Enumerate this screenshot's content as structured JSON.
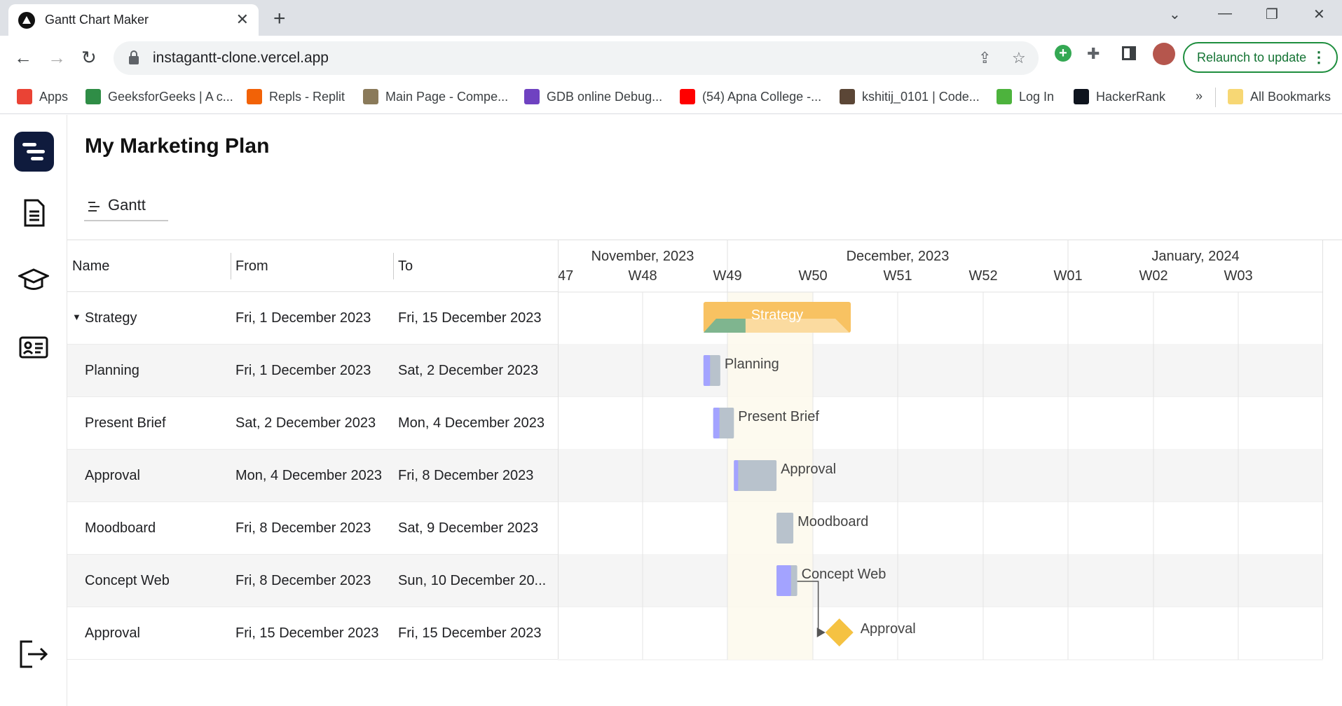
{
  "browser": {
    "tab_title": "Gantt Chart Maker",
    "url": "instagantt-clone.vercel.app",
    "relaunch_label": "Relaunch to update",
    "bookmarks": [
      {
        "label": "Apps",
        "color": "#ea4335"
      },
      {
        "label": "GeeksforGeeks | A c...",
        "color": "#2f8d46"
      },
      {
        "label": "Repls - Replit",
        "color": "#f26207"
      },
      {
        "label": "Main Page - Compe...",
        "color": "#8a7a5a"
      },
      {
        "label": "GDB online Debug...",
        "color": "#6f42c1"
      },
      {
        "label": "(54) Apna College -...",
        "color": "#ff0000"
      },
      {
        "label": "kshitij_0101 | Code...",
        "color": "#5b4636"
      },
      {
        "label": "Log In",
        "color": "#4db33d"
      },
      {
        "label": "HackerRank",
        "color": "#0e141e"
      }
    ],
    "all_bookmarks_label": "All Bookmarks",
    "more_label": "»"
  },
  "app": {
    "title": "My Marketing Plan",
    "view_tab": "Gantt"
  },
  "grid": {
    "headers": {
      "name": "Name",
      "from": "From",
      "to": "To"
    },
    "rows": [
      {
        "name": "Strategy",
        "from": "Fri, 1 December 2023",
        "to": "Fri, 15 December 2023",
        "type": "project",
        "expander": "▼"
      },
      {
        "name": "Planning",
        "from": "Fri, 1 December 2023",
        "to": "Sat, 2 December 2023",
        "type": "task"
      },
      {
        "name": "Present Brief",
        "from": "Sat, 2 December 2023",
        "to": "Mon, 4 December 2023",
        "type": "task"
      },
      {
        "name": "Approval",
        "from": "Mon, 4 December 2023",
        "to": "Fri, 8 December 2023",
        "type": "task"
      },
      {
        "name": "Moodboard",
        "from": "Fri, 8 December 2023",
        "to": "Sat, 9 December 2023",
        "type": "task"
      },
      {
        "name": "Concept Web",
        "from": "Fri, 8 December 2023",
        "to": "Sun, 10 December 20...",
        "type": "task"
      },
      {
        "name": "Approval",
        "from": "Fri, 15 December 2023",
        "to": "Fri, 15 December 2023",
        "type": "milestone"
      }
    ]
  },
  "timeline": {
    "months": [
      "November, 2023",
      "December, 2023",
      "January, 2024"
    ],
    "weeks": [
      "47",
      "W48",
      "W49",
      "W50",
      "W51",
      "W52",
      "W01",
      "W02",
      "W03"
    ],
    "bar_labels": [
      "Strategy",
      "Planning",
      "Present Brief",
      "Approval",
      "Moodboard",
      "Concept Web",
      "Approval"
    ],
    "colors": {
      "project_bar": "#f8c262",
      "project_progress": "#7fb58f",
      "task_bar": "#b8c2cc",
      "task_progress": "#a3a3ff",
      "milestone": "#f5c242",
      "current_week": "#fdf9ec"
    }
  }
}
